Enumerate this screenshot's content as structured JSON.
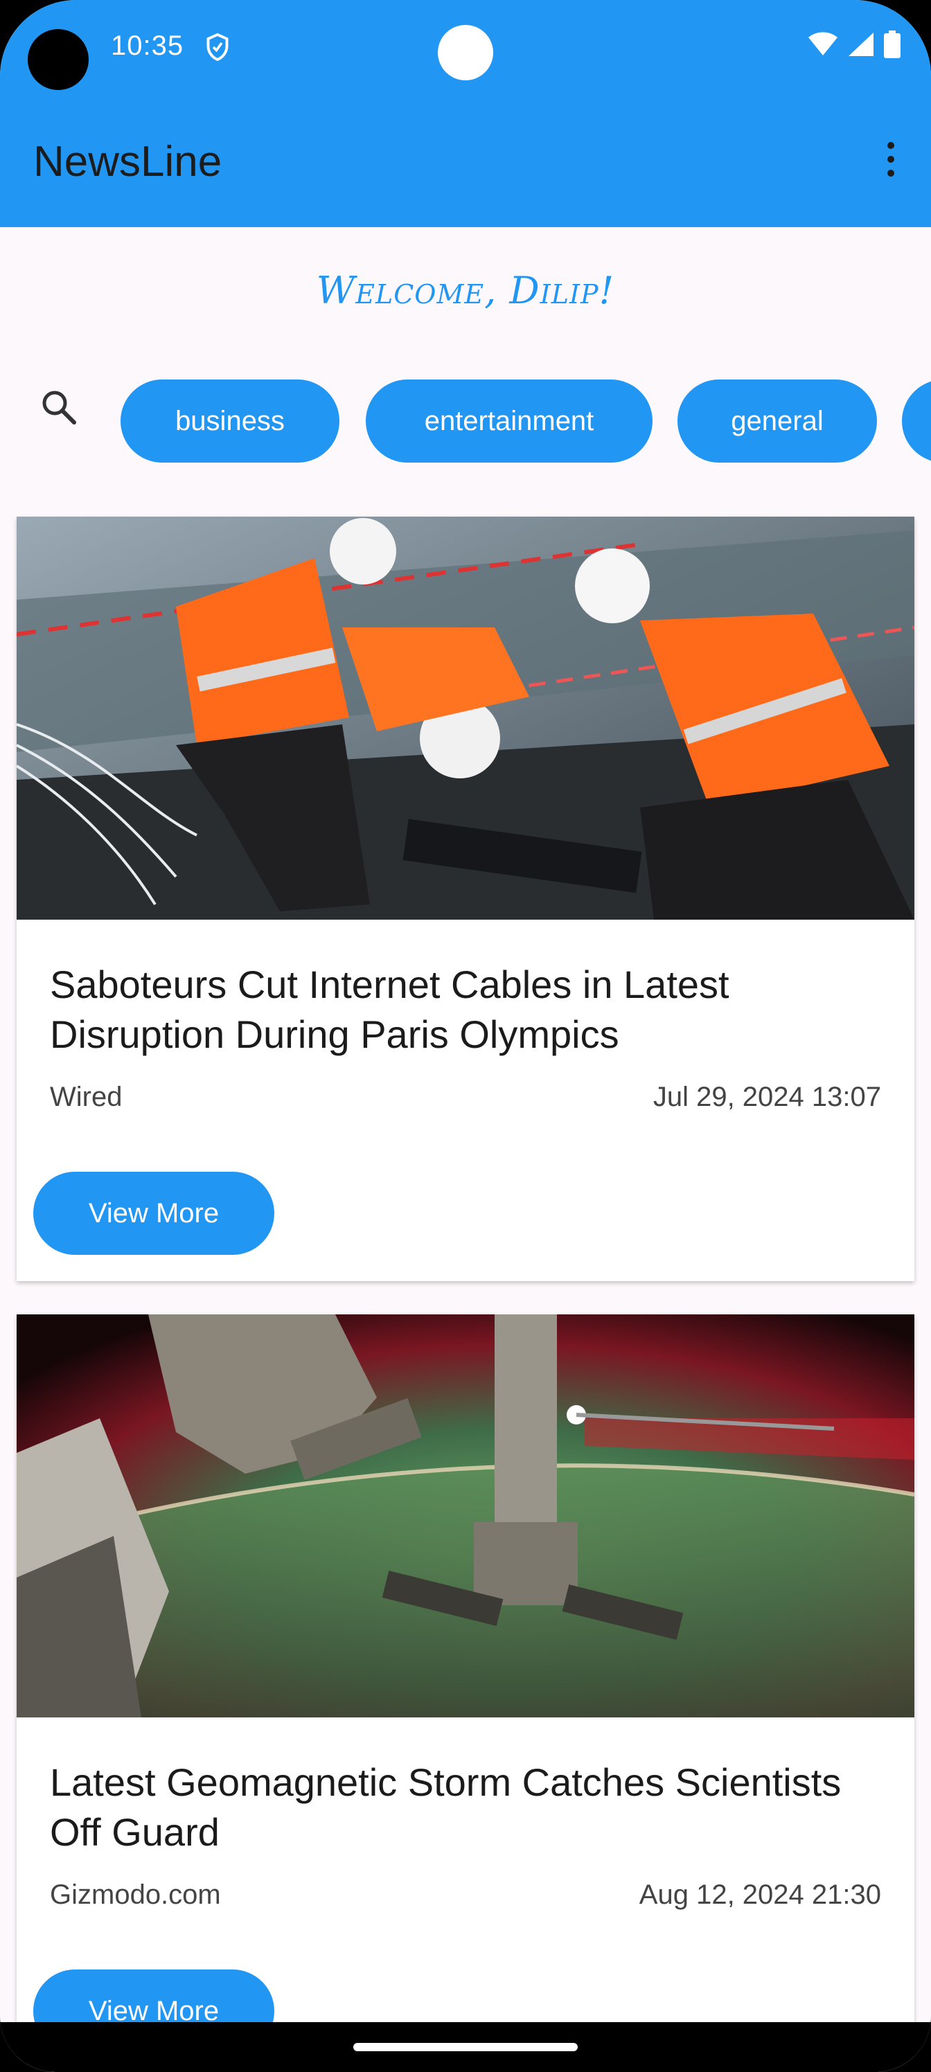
{
  "status_bar": {
    "time": "10:35",
    "icons": [
      "shield-icon",
      "wifi-icon",
      "signal-icon",
      "battery-icon"
    ]
  },
  "app_bar": {
    "title": "NewsLine",
    "menu_icon": "more-vert-icon"
  },
  "welcome": "Welcome, Dilip!",
  "categories": [
    "business",
    "entertainment",
    "general"
  ],
  "colors": {
    "accent": "#2196f3",
    "background": "#fdf8fc",
    "text": "#1b1b1b"
  },
  "articles": [
    {
      "title": "Saboteurs Cut Internet Cables in Latest Disruption During Paris Olympics",
      "source": "Wired",
      "date": "Jul 29, 2024 13:07",
      "button": "View More",
      "image": "workers-in-orange-vests-photo"
    },
    {
      "title": "Latest Geomagnetic Storm Catches Scientists Off Guard",
      "source": "Gizmodo.com",
      "date": "Aug 12, 2024 21:30",
      "button": "View More",
      "image": "aurora-from-space-station-photo"
    }
  ]
}
